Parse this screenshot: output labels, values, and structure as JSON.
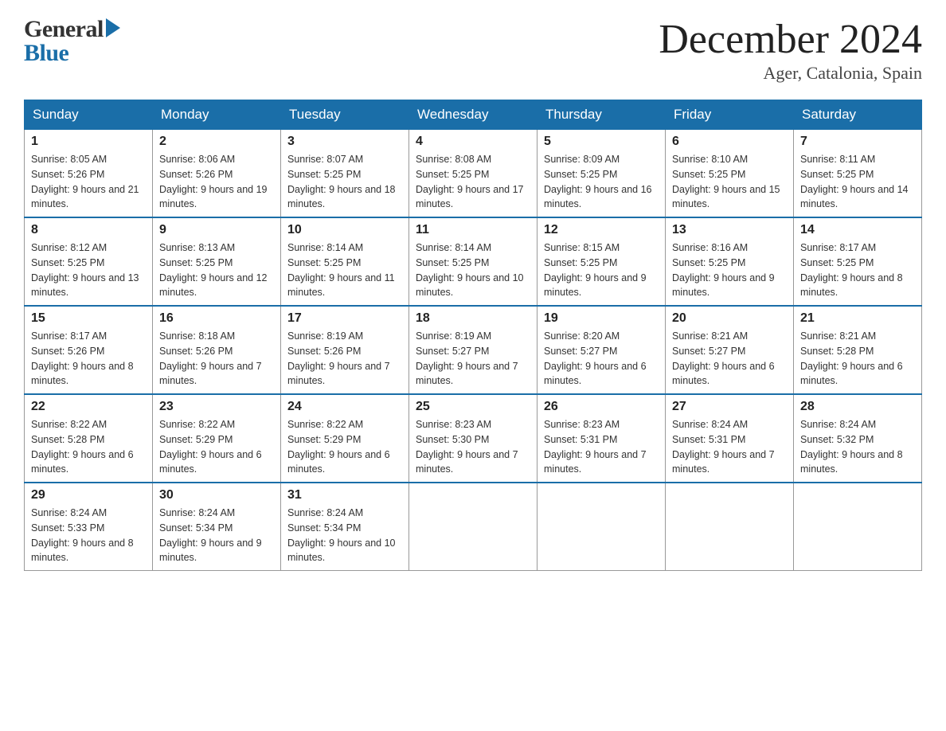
{
  "header": {
    "logo_general": "General",
    "logo_blue": "Blue",
    "month_year": "December 2024",
    "location": "Ager, Catalonia, Spain"
  },
  "days_of_week": [
    "Sunday",
    "Monday",
    "Tuesday",
    "Wednesday",
    "Thursday",
    "Friday",
    "Saturday"
  ],
  "weeks": [
    [
      {
        "day": "1",
        "sunrise": "8:05 AM",
        "sunset": "5:26 PM",
        "daylight": "9 hours and 21 minutes."
      },
      {
        "day": "2",
        "sunrise": "8:06 AM",
        "sunset": "5:26 PM",
        "daylight": "9 hours and 19 minutes."
      },
      {
        "day": "3",
        "sunrise": "8:07 AM",
        "sunset": "5:25 PM",
        "daylight": "9 hours and 18 minutes."
      },
      {
        "day": "4",
        "sunrise": "8:08 AM",
        "sunset": "5:25 PM",
        "daylight": "9 hours and 17 minutes."
      },
      {
        "day": "5",
        "sunrise": "8:09 AM",
        "sunset": "5:25 PM",
        "daylight": "9 hours and 16 minutes."
      },
      {
        "day": "6",
        "sunrise": "8:10 AM",
        "sunset": "5:25 PM",
        "daylight": "9 hours and 15 minutes."
      },
      {
        "day": "7",
        "sunrise": "8:11 AM",
        "sunset": "5:25 PM",
        "daylight": "9 hours and 14 minutes."
      }
    ],
    [
      {
        "day": "8",
        "sunrise": "8:12 AM",
        "sunset": "5:25 PM",
        "daylight": "9 hours and 13 minutes."
      },
      {
        "day": "9",
        "sunrise": "8:13 AM",
        "sunset": "5:25 PM",
        "daylight": "9 hours and 12 minutes."
      },
      {
        "day": "10",
        "sunrise": "8:14 AM",
        "sunset": "5:25 PM",
        "daylight": "9 hours and 11 minutes."
      },
      {
        "day": "11",
        "sunrise": "8:14 AM",
        "sunset": "5:25 PM",
        "daylight": "9 hours and 10 minutes."
      },
      {
        "day": "12",
        "sunrise": "8:15 AM",
        "sunset": "5:25 PM",
        "daylight": "9 hours and 9 minutes."
      },
      {
        "day": "13",
        "sunrise": "8:16 AM",
        "sunset": "5:25 PM",
        "daylight": "9 hours and 9 minutes."
      },
      {
        "day": "14",
        "sunrise": "8:17 AM",
        "sunset": "5:25 PM",
        "daylight": "9 hours and 8 minutes."
      }
    ],
    [
      {
        "day": "15",
        "sunrise": "8:17 AM",
        "sunset": "5:26 PM",
        "daylight": "9 hours and 8 minutes."
      },
      {
        "day": "16",
        "sunrise": "8:18 AM",
        "sunset": "5:26 PM",
        "daylight": "9 hours and 7 minutes."
      },
      {
        "day": "17",
        "sunrise": "8:19 AM",
        "sunset": "5:26 PM",
        "daylight": "9 hours and 7 minutes."
      },
      {
        "day": "18",
        "sunrise": "8:19 AM",
        "sunset": "5:27 PM",
        "daylight": "9 hours and 7 minutes."
      },
      {
        "day": "19",
        "sunrise": "8:20 AM",
        "sunset": "5:27 PM",
        "daylight": "9 hours and 6 minutes."
      },
      {
        "day": "20",
        "sunrise": "8:21 AM",
        "sunset": "5:27 PM",
        "daylight": "9 hours and 6 minutes."
      },
      {
        "day": "21",
        "sunrise": "8:21 AM",
        "sunset": "5:28 PM",
        "daylight": "9 hours and 6 minutes."
      }
    ],
    [
      {
        "day": "22",
        "sunrise": "8:22 AM",
        "sunset": "5:28 PM",
        "daylight": "9 hours and 6 minutes."
      },
      {
        "day": "23",
        "sunrise": "8:22 AM",
        "sunset": "5:29 PM",
        "daylight": "9 hours and 6 minutes."
      },
      {
        "day": "24",
        "sunrise": "8:22 AM",
        "sunset": "5:29 PM",
        "daylight": "9 hours and 6 minutes."
      },
      {
        "day": "25",
        "sunrise": "8:23 AM",
        "sunset": "5:30 PM",
        "daylight": "9 hours and 7 minutes."
      },
      {
        "day": "26",
        "sunrise": "8:23 AM",
        "sunset": "5:31 PM",
        "daylight": "9 hours and 7 minutes."
      },
      {
        "day": "27",
        "sunrise": "8:24 AM",
        "sunset": "5:31 PM",
        "daylight": "9 hours and 7 minutes."
      },
      {
        "day": "28",
        "sunrise": "8:24 AM",
        "sunset": "5:32 PM",
        "daylight": "9 hours and 8 minutes."
      }
    ],
    [
      {
        "day": "29",
        "sunrise": "8:24 AM",
        "sunset": "5:33 PM",
        "daylight": "9 hours and 8 minutes."
      },
      {
        "day": "30",
        "sunrise": "8:24 AM",
        "sunset": "5:34 PM",
        "daylight": "9 hours and 9 minutes."
      },
      {
        "day": "31",
        "sunrise": "8:24 AM",
        "sunset": "5:34 PM",
        "daylight": "9 hours and 10 minutes."
      },
      null,
      null,
      null,
      null
    ]
  ]
}
